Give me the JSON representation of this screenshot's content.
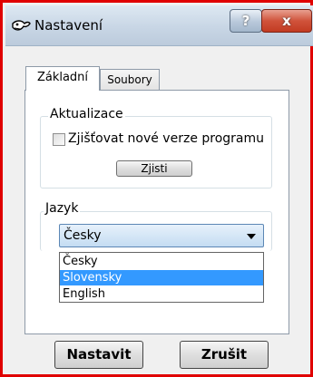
{
  "window": {
    "title": "Nastavení",
    "help_label": "?",
    "close_label": "x"
  },
  "tabs": [
    {
      "label": "Základní",
      "active": true
    },
    {
      "label": "Soubory",
      "active": false
    }
  ],
  "update_group": {
    "legend": "Aktualizace",
    "checkbox_label": "Zjišťovat nové verze programu",
    "checkbox_checked": false,
    "button_label": "Zjisti"
  },
  "language_group": {
    "legend": "Jazyk",
    "selected": "Česky",
    "options": [
      "Česky",
      "Slovensky",
      "English"
    ],
    "highlighted": "Slovensky"
  },
  "footer": {
    "ok_label": "Nastavit",
    "cancel_label": "Zrušit"
  },
  "colors": {
    "frame_border": "#e00000",
    "highlight": "#3399ff",
    "close_button": "#c23b22"
  }
}
